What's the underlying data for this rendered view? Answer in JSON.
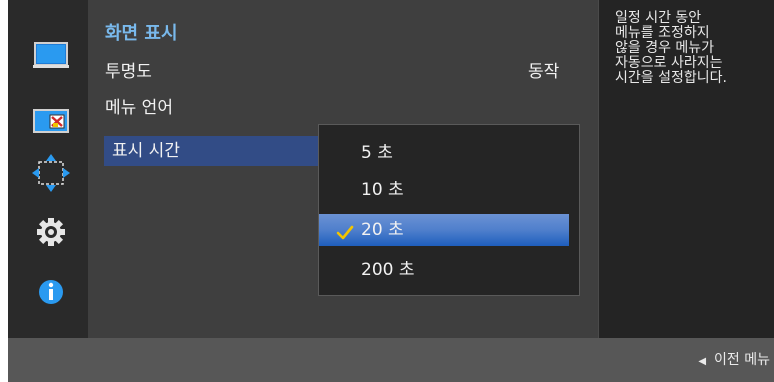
{
  "sidebar": {
    "icons": [
      {
        "name": "monitor-icon"
      },
      {
        "name": "picture-in-picture-icon"
      },
      {
        "name": "move-arrows-icon"
      },
      {
        "name": "gear-icon"
      },
      {
        "name": "info-icon"
      }
    ]
  },
  "menu": {
    "title": "화면 표시",
    "items": [
      {
        "label": "투명도",
        "value": "동작"
      },
      {
        "label": "메뉴 언어"
      },
      {
        "label": "표시 시간"
      }
    ]
  },
  "popup": {
    "options": [
      {
        "label": "5 초",
        "selected": false
      },
      {
        "label": "10 초",
        "selected": false
      },
      {
        "label": "20 초",
        "selected": true
      },
      {
        "label": "200 초",
        "selected": false
      }
    ]
  },
  "help": {
    "text": "일정 시간 동안\n메뉴를 조정하지\n않을 경우 메뉴가\n자동으로 사라지는\n시간을 설정합니다."
  },
  "footer": {
    "back_label": "이전 메뉴"
  },
  "colors": {
    "accent_title": "#79b9ec",
    "selected_row": "#324c86",
    "selected_option": "#4f7fcc",
    "check": "#f2c500"
  }
}
